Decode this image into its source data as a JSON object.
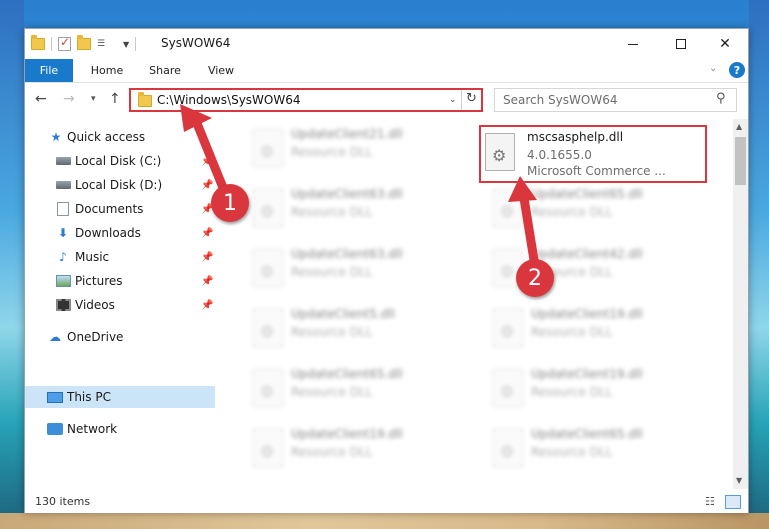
{
  "window": {
    "title": "SysWOW64"
  },
  "ribbon": {
    "tabs": [
      "File",
      "Home",
      "Share",
      "View"
    ]
  },
  "navigation": {
    "address": "C:\\Windows\\SysWOW64",
    "search_placeholder": "Search SysWOW64"
  },
  "sidebar": {
    "items": [
      {
        "label": "Quick access",
        "icon": "star-icon",
        "pinned": false
      },
      {
        "label": "Local Disk (C:)",
        "icon": "drive-icon",
        "pinned": true
      },
      {
        "label": "Local Disk (D:)",
        "icon": "drive-icon",
        "pinned": true
      },
      {
        "label": "Documents",
        "icon": "documents-icon",
        "pinned": true
      },
      {
        "label": "Downloads",
        "icon": "downloads-icon",
        "pinned": true
      },
      {
        "label": "Music",
        "icon": "music-icon",
        "pinned": true
      },
      {
        "label": "Pictures",
        "icon": "pictures-icon",
        "pinned": true
      },
      {
        "label": "Videos",
        "icon": "videos-icon",
        "pinned": true
      },
      {
        "label": "OneDrive",
        "icon": "onedrive-icon",
        "pinned": false
      },
      {
        "label": "This PC",
        "icon": "this-pc-icon",
        "pinned": false,
        "selected": true
      },
      {
        "label": "Network",
        "icon": "network-icon",
        "pinned": false
      }
    ]
  },
  "files": {
    "highlighted": {
      "name": "mscsasphelp.dll",
      "version": "4.0.1655.0",
      "description": "Microsoft Commerce ..."
    },
    "left_column": [
      {
        "name": "UpdateClient21.dll",
        "type": "Resource DLL"
      },
      {
        "name": "UpdateClient63.dll",
        "type": "Resource DLL"
      },
      {
        "name": "UpdateClient63.dll",
        "type": "Resource DLL"
      },
      {
        "name": "UpdateClient5.dll",
        "type": "Resource DLL"
      },
      {
        "name": "UpdateClient65.dll",
        "type": "Resource DLL"
      },
      {
        "name": "UpdateClient19.dll",
        "type": "Resource DLL"
      }
    ],
    "right_column": [
      {
        "name": "UpdateClient65.dll",
        "type": "Resource DLL"
      },
      {
        "name": "UpdateClient42.dll",
        "type": "Resource DLL"
      },
      {
        "name": "UpdateClient19.dll",
        "type": "Resource DLL"
      },
      {
        "name": "UpdateClient19.dll",
        "type": "Resource DLL"
      },
      {
        "name": "UpdateClient65.dll",
        "type": "Resource DLL"
      }
    ]
  },
  "status": {
    "item_count": "130 items"
  },
  "annotations": {
    "badge_1": "1",
    "badge_2": "2",
    "color": "#d9363e"
  }
}
